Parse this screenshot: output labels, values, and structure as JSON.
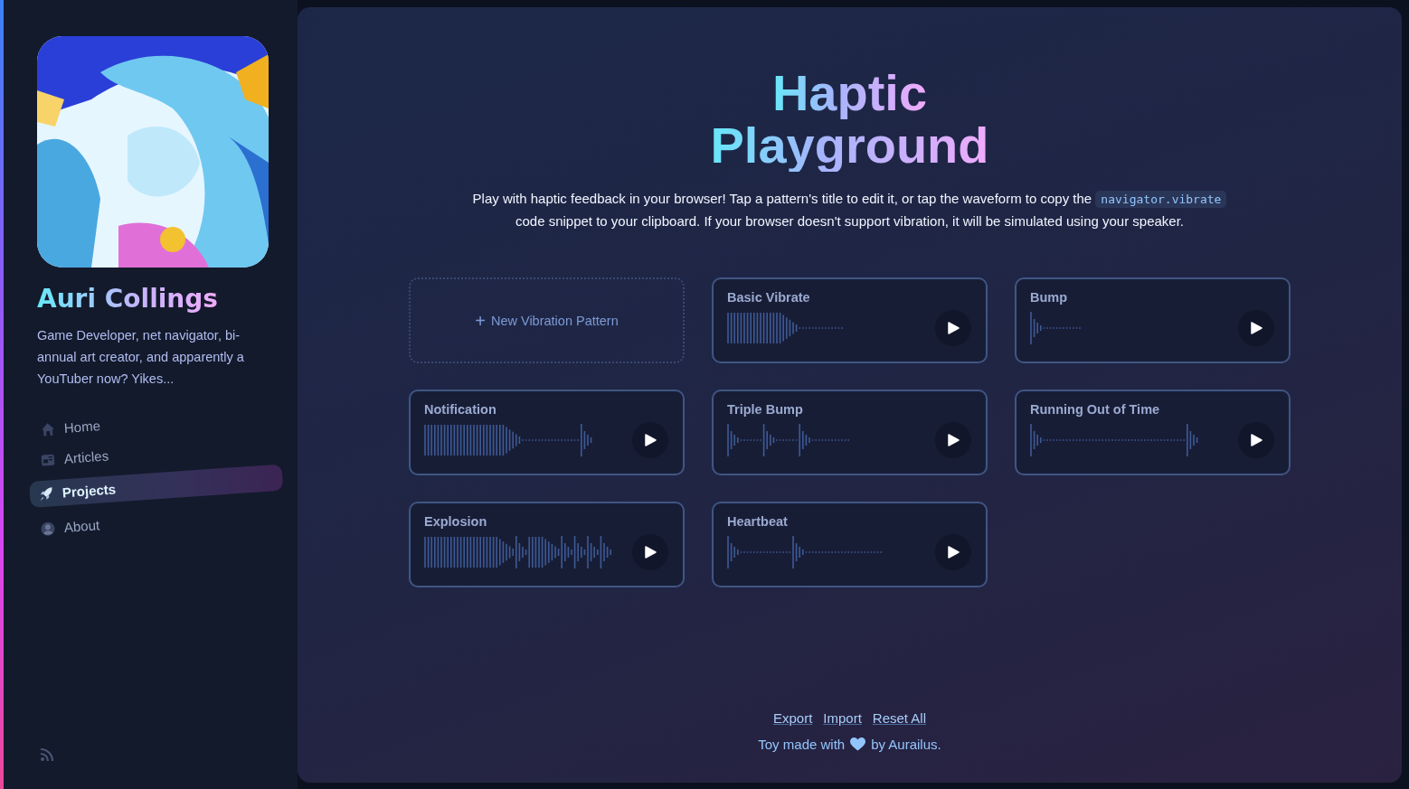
{
  "profile": {
    "name": "Auri Collings",
    "bio": "Game Developer, net navigator, bi-annual art creator, and apparently a YouTuber now? Yikes..."
  },
  "nav": [
    {
      "label": "Home",
      "selected": false
    },
    {
      "label": "Articles",
      "selected": false
    },
    {
      "label": "Projects",
      "selected": true
    },
    {
      "label": "About",
      "selected": false
    }
  ],
  "title": {
    "line_1": "Haptic",
    "line_2": "Playground"
  },
  "description": {
    "before": "Play with haptic feedback in your browser! Tap a pattern's title to edit it, or tap the waveform to copy the",
    "code": "navigator.vibrate",
    "after": "code snippet to your clipboard. If your browser doesn't support vibration, it will be simulated using your speaker."
  },
  "new_pattern": {
    "icon": "+",
    "label": "New Vibration Pattern"
  },
  "patterns": [
    {
      "title": "Basic Vibrate"
    },
    {
      "title": "Bump"
    },
    {
      "title": "Notification"
    },
    {
      "title": "Triple Bump"
    },
    {
      "title": "Running Out of Time"
    },
    {
      "title": "Explosion"
    },
    {
      "title": "Heartbeat"
    }
  ],
  "footer": {
    "links": [
      "Export",
      "Import",
      "Reset All"
    ],
    "credit_before": "Toy made with",
    "credit_after": "by Aurailus."
  }
}
